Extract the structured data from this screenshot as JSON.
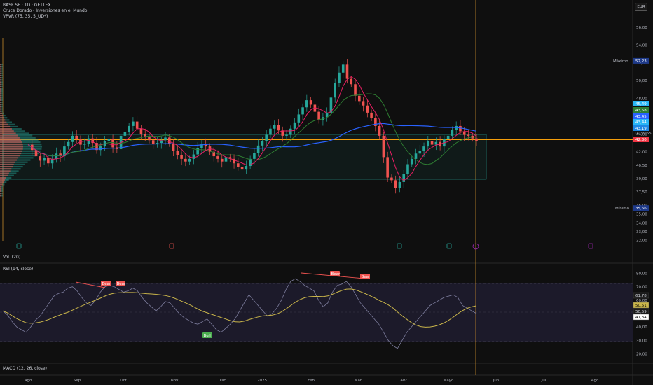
{
  "header": {
    "symbol": "BASF SE · 1D · GETTEX",
    "indicator1": "Cruce Dorado - Inversiones en el Mundo",
    "indicator2": "VPVR (75, 35, 5_UD*)",
    "currency": "EUR"
  },
  "volume_label": "Vol. (20)",
  "rsi_label": "RSI (14, close)",
  "macd_label": "MACD (12, 26, close)",
  "price_axis": {
    "ticks": [
      "56,00",
      "54,00",
      "52,00",
      "50,00",
      "48,00",
      "46,00",
      "44,00",
      "42,00",
      "40,50",
      "39,00",
      "37,50",
      "36,00",
      "35,00",
      "34,00",
      "33,00",
      "32,00"
    ],
    "maximo_label": "Máximo",
    "maximo_value": "52,23",
    "minimo_label": "Mínimo",
    "minimo_value": "35,66",
    "tags": [
      "45,49",
      "43,58",
      "43,45",
      "43,44",
      "43,19",
      "42,30"
    ],
    "countdown": "14:30:55"
  },
  "rsi_axis": {
    "ticks": [
      "80,00",
      "70,00",
      "60,00",
      "40,00",
      "30,00",
      "20,00"
    ],
    "tags": [
      "61,78",
      "50,51",
      "50,59",
      "47,34"
    ],
    "signals": [
      "Bear",
      "Bear",
      "Bull",
      "Bear",
      "Bear"
    ]
  },
  "colors": {
    "bull": "#26a69a",
    "bear": "#ef5350",
    "ma_fast": "#e91e63",
    "ma_slow": "#2e7d32",
    "ma_blue": "#2962ff",
    "poc": "#f59e0b",
    "rsi": "#7e7e9e",
    "rsi_ma": "#c9b54a"
  },
  "chart_data": {
    "type": "candlestick",
    "x_labels": [
      "Ago",
      "Sep",
      "Oct",
      "Nov",
      "Dic",
      "2025",
      "Feb",
      "Mar",
      "Abr",
      "Mayo",
      "Jun",
      "Jul",
      "Ago"
    ],
    "ylim": [
      31.5,
      57.5
    ],
    "close_series": [
      42.8,
      42.2,
      41.5,
      41.0,
      41.3,
      40.7,
      41.2,
      41.8,
      41.5,
      42.6,
      43.1,
      43.8,
      43.4,
      42.8,
      42.9,
      43.5,
      43.0,
      42.2,
      42.6,
      43.2,
      43.4,
      42.5,
      42.3,
      43.8,
      44.2,
      44.9,
      45.4,
      44.6,
      44.0,
      43.7,
      43.3,
      42.9,
      43.0,
      43.3,
      43.6,
      42.9,
      42.1,
      41.6,
      41.2,
      40.9,
      41.2,
      41.7,
      42.4,
      42.9,
      42.6,
      42.0,
      41.5,
      41.2,
      40.9,
      41.4,
      41.2,
      40.7,
      40.3,
      40.0,
      40.4,
      41.2,
      41.9,
      42.7,
      43.2,
      43.9,
      44.6,
      45.0,
      44.4,
      43.8,
      43.9,
      44.6,
      45.3,
      46.2,
      47.0,
      47.8,
      47.3,
      46.5,
      45.6,
      45.9,
      46.4,
      48.1,
      49.7,
      50.9,
      51.8,
      50.2,
      49.6,
      48.3,
      47.7,
      47.2,
      46.4,
      45.8,
      44.9,
      43.8,
      41.4,
      39.1,
      38.8,
      37.9,
      38.6,
      39.5,
      40.6,
      41.2,
      41.8,
      42.1,
      42.6,
      43.2,
      42.8,
      43.1,
      42.6,
      43.4,
      43.8,
      44.5,
      44.9,
      44.3,
      43.9,
      43.8,
      43.5,
      43.2
    ],
    "series": [
      {
        "name": "",
        "values": []
      }
    ],
    "rsi_values": [
      52,
      49,
      44,
      40,
      38,
      36,
      40,
      45,
      48,
      53,
      58,
      63,
      65,
      66,
      69,
      70,
      67,
      62,
      58,
      56,
      60,
      66,
      70,
      71,
      70,
      68,
      66,
      67,
      69,
      67,
      62,
      58,
      55,
      52,
      55,
      59,
      58,
      54,
      50,
      47,
      45,
      43,
      42,
      44,
      46,
      42,
      38,
      36,
      39,
      42,
      46,
      52,
      58,
      64,
      60,
      56,
      52,
      48,
      50,
      54,
      60,
      68,
      74,
      76,
      74,
      71,
      69,
      67,
      60,
      55,
      58,
      66,
      71,
      72,
      74,
      70,
      64,
      58,
      54,
      50,
      46,
      42,
      36,
      30,
      26,
      24,
      30,
      36,
      40,
      44,
      48,
      52,
      56,
      58,
      60,
      62,
      63,
      64,
      62,
      56,
      54,
      52,
      50
    ]
  }
}
